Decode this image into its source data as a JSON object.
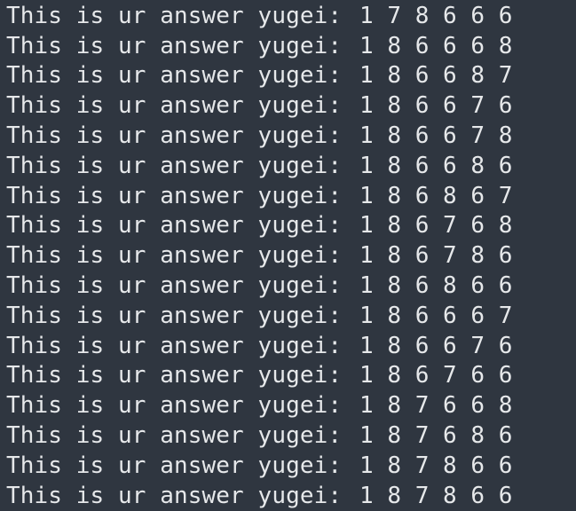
{
  "terminal": {
    "lines": [
      {
        "prefix": "This is ur answer yugei:",
        "value": "178666"
      },
      {
        "prefix": "This is ur answer yugei:",
        "value": "186668"
      },
      {
        "prefix": "This is ur answer yugei:",
        "value": "186687"
      },
      {
        "prefix": "This is ur answer yugei:",
        "value": "186676"
      },
      {
        "prefix": "This is ur answer yugei:",
        "value": "186678"
      },
      {
        "prefix": "This is ur answer yugei:",
        "value": "186686"
      },
      {
        "prefix": "This is ur answer yugei:",
        "value": "186867"
      },
      {
        "prefix": "This is ur answer yugei:",
        "value": "186768"
      },
      {
        "prefix": "This is ur answer yugei:",
        "value": "186786"
      },
      {
        "prefix": "This is ur answer yugei:",
        "value": "186866"
      },
      {
        "prefix": "This is ur answer yugei:",
        "value": "186667"
      },
      {
        "prefix": "This is ur answer yugei:",
        "value": "186676"
      },
      {
        "prefix": "This is ur answer yugei:",
        "value": "186766"
      },
      {
        "prefix": "This is ur answer yugei:",
        "value": "187668"
      },
      {
        "prefix": "This is ur answer yugei:",
        "value": "187686"
      },
      {
        "prefix": "This is ur answer yugei:",
        "value": "187866"
      },
      {
        "prefix": "This is ur answer yugei:",
        "value": "187866"
      }
    ]
  }
}
